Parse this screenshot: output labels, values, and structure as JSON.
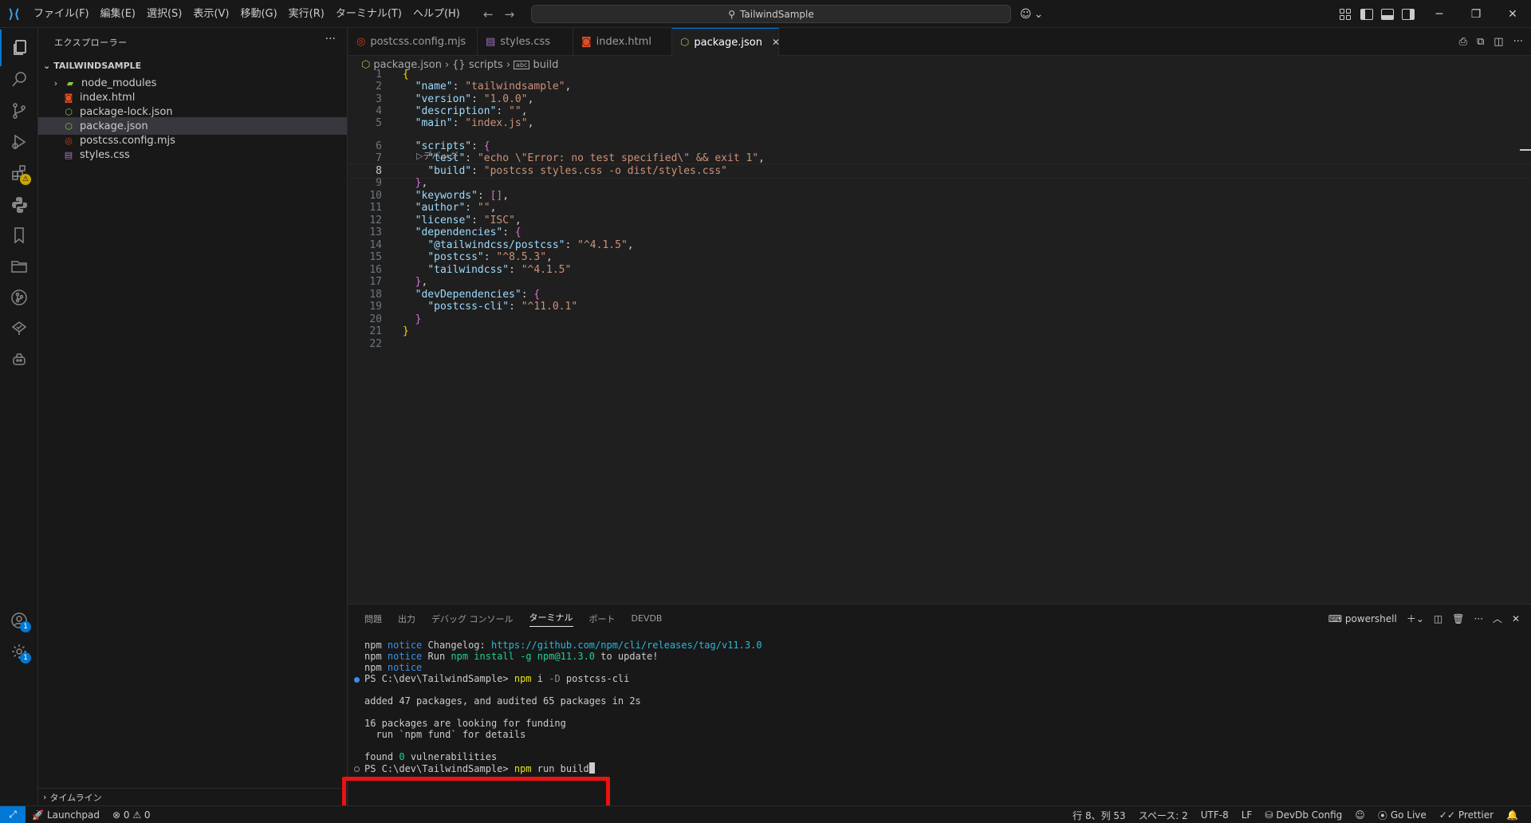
{
  "menu": [
    "ファイル(F)",
    "編集(E)",
    "選択(S)",
    "表示(V)",
    "移動(G)",
    "実行(R)",
    "ターミナル(T)",
    "ヘルプ(H)"
  ],
  "command_center": "TailwindSample",
  "sidebar": {
    "title": "エクスプローラー",
    "project": "TAILWINDSAMPLE",
    "items": [
      {
        "label": "node_modules",
        "icon": "folder-icon"
      },
      {
        "label": "index.html",
        "icon": "html-icon"
      },
      {
        "label": "package-lock.json",
        "icon": "json-icon"
      },
      {
        "label": "package.json",
        "icon": "json-icon"
      },
      {
        "label": "postcss.config.mjs",
        "icon": "postcss-icon"
      },
      {
        "label": "styles.css",
        "icon": "css-icon"
      }
    ],
    "timeline": "タイムライン"
  },
  "tabs": [
    {
      "label": "postcss.config.mjs"
    },
    {
      "label": "styles.css"
    },
    {
      "label": "index.html"
    },
    {
      "label": "package.json"
    }
  ],
  "breadcrumb": {
    "file": "package.json",
    "scripts": "{} scripts",
    "build": "build"
  },
  "codelens": "▷デバッグ",
  "code_lines": [
    "1",
    "2",
    "3",
    "4",
    "5",
    "6",
    "7",
    "8",
    "9",
    "10",
    "11",
    "12",
    "13",
    "14",
    "15",
    "16",
    "17",
    "18",
    "19",
    "20",
    "21",
    "22"
  ],
  "code": {
    "name_key": "\"name\"",
    "name_val": "\"tailwindsample\"",
    "version_key": "\"version\"",
    "version_val": "\"1.0.0\"",
    "description_key": "\"description\"",
    "description_val": "\"\"",
    "main_key": "\"main\"",
    "main_val": "\"index.js\"",
    "scripts_key": "\"scripts\"",
    "test_key": "\"test\"",
    "test_val": "\"echo \\\"Error: no test specified\\\" && exit 1\"",
    "build_key": "\"build\"",
    "build_val": "\"postcss styles.css -o dist/styles.css\"",
    "keywords_key": "\"keywords\"",
    "author_key": "\"author\"",
    "author_val": "\"\"",
    "license_key": "\"license\"",
    "license_val": "\"ISC\"",
    "dependencies_key": "\"dependencies\"",
    "dep1_key": "\"@tailwindcss/postcss\"",
    "dep1_val": "\"^4.1.5\"",
    "dep2_key": "\"postcss\"",
    "dep2_val": "\"^8.5.3\"",
    "dep3_key": "\"tailwindcss\"",
    "dep3_val": "\"^4.1.5\"",
    "devdeps_key": "\"devDependencies\"",
    "devdep1_key": "\"postcss-cli\"",
    "devdep1_val": "\"^11.0.1\""
  },
  "panel": {
    "tabs": [
      "問題",
      "出力",
      "デバッグ コンソール",
      "ターミナル",
      "ポート",
      "DEVDB"
    ],
    "shell": "powershell"
  },
  "terminal": {
    "l1_npm": "npm",
    "l1_notice": "notice",
    "l1_text": " Changelog: ",
    "l1_link": "https://github.com/npm/cli/releases/tag/v11.3.0",
    "l2_npm": "npm",
    "l2_notice": "notice",
    "l2_a": " Run ",
    "l2_cmd": "npm install -g npm@11.3.0",
    "l2_b": " to update!",
    "l3_npm": "npm",
    "l3_notice": "notice",
    "l4_prompt": "PS C:\\dev\\TailwindSample> ",
    "l4_cmd": "npm",
    "l4_rest": " i ",
    "l4_flag": "-D",
    "l4_pkg": " postcss-cli",
    "l5": "added 47 packages, and audited 65 packages in 2s",
    "l6": "16 packages are looking for funding",
    "l7": "  run `npm fund` for details",
    "l8a": "found ",
    "l8n": "0",
    "l8b": " vulnerabilities",
    "l9_prompt": "PS C:\\dev\\TailwindSample> ",
    "l9_cmd": "npm",
    "l9_rest": " run build"
  },
  "statusbar": {
    "launchpad": "Launchpad",
    "problems": "⊗ 0 ⚠ 0",
    "position": "行 8、列 53",
    "spaces": "スペース: 2",
    "encoding": "UTF-8",
    "eol": "LF",
    "devdb": "DevDb Config",
    "golive": "Go Live",
    "prettier": "Prettier"
  },
  "colors": {
    "accent": "#0078d4",
    "highlight": "#ee1111"
  }
}
